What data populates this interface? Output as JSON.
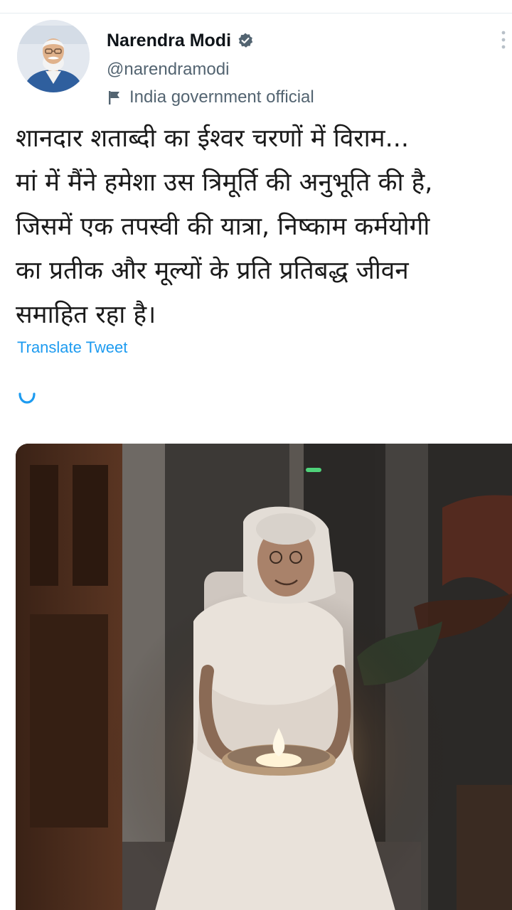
{
  "author": {
    "display_name": "Narendra Modi",
    "handle": "@narendramodi",
    "affiliation_label": "India government official",
    "verified": true,
    "avatar_icon": "profile-photo",
    "verified_icon": "verified-badge-icon",
    "label_icon": "flag-icon"
  },
  "tweet": {
    "text_lines": [
      "शानदार शताब्दी का ईश्वर चरणों में विराम...",
      "मां में मैंने हमेशा उस त्रिमूर्ति की अनुभूति की है,",
      "जिसमें एक तपस्वी की यात्रा, निष्काम कर्मयोगी",
      "का प्रतीक और मूल्यों के प्रति प्रतिबद्ध जीवन",
      "समाहित रहा है।"
    ],
    "translate_label": "Translate Tweet"
  },
  "colors": {
    "link": "#1d9bf0",
    "secondary_text": "#536471",
    "verified_badge": "#536471"
  },
  "icons": {
    "more": "more-vertical-icon",
    "loading": "loading-spinner-icon"
  }
}
